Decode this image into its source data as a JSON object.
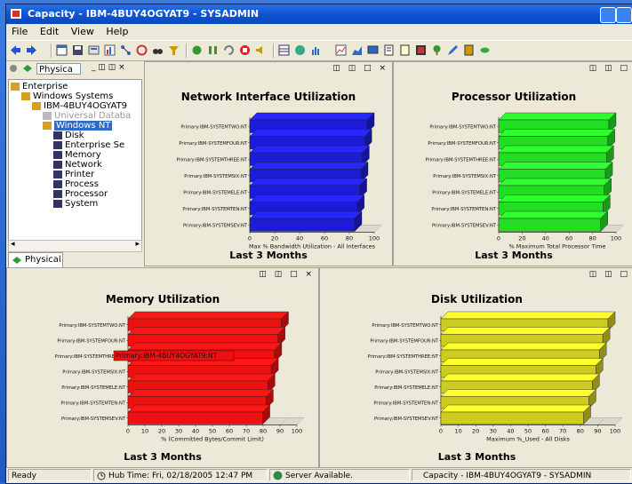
{
  "window": {
    "title": "Capacity - IBM-4BUY4OGYAT9 - SYSADMIN"
  },
  "menu": [
    "File",
    "Edit",
    "View",
    "Help"
  ],
  "navigator": {
    "selector": "Physica",
    "tree": [
      {
        "label": "Enterprise",
        "level": 0
      },
      {
        "label": "Windows Systems",
        "level": 1
      },
      {
        "label": "IBM-4BUY4OGYAT9",
        "level": 2
      },
      {
        "label": "Universal Databa",
        "level": 3,
        "dim": true
      },
      {
        "label": "Windows NT",
        "level": 3,
        "selected": true
      },
      {
        "label": "Disk",
        "level": 4
      },
      {
        "label": "Enterprise Se",
        "level": 4
      },
      {
        "label": "Memory",
        "level": 4
      },
      {
        "label": "Network",
        "level": 4
      },
      {
        "label": "Printer",
        "level": 4
      },
      {
        "label": "Process",
        "level": 4
      },
      {
        "label": "Processor",
        "level": 4
      },
      {
        "label": "System",
        "level": 4
      }
    ],
    "tab": "Physical"
  },
  "panels": {
    "network": {
      "title": "Network Interface Utilization",
      "footer": "Last 3 Months"
    },
    "processor": {
      "title": "Processor Utilization",
      "footer": "Last 3 Months"
    },
    "memory": {
      "title": "Memory Utilization",
      "footer": "Last 3 Months"
    },
    "disk": {
      "title": "Disk Utilization",
      "footer": "Last 3 Months"
    }
  },
  "chart_data": [
    {
      "type": "bar",
      "orientation": "horizontal",
      "title": "Network Interface Utilization",
      "xlabel": "Max % Bandwidth Utilization - All Interfaces",
      "categories": [
        "Primary:IBM-SYSTEMTWO:NT",
        "Primary:IBM-SYSTEMFOUR:NT",
        "Primary:IBM-SYSTEMTHREE:NT",
        "Primary:IBM-SYSTEMSIX:NT",
        "Primary:IBM-SYSTEMELE:NT",
        "Primary:IBM-SYSTEMTEN:NT",
        "Primary:IBM-SYSTEMSEV:NT"
      ],
      "values": [
        100,
        98,
        96,
        95,
        94,
        92,
        90
      ],
      "xlim": [
        0,
        100
      ],
      "ticks": [
        0,
        20,
        40,
        60,
        80,
        100
      ],
      "color": "#1c1cd8"
    },
    {
      "type": "bar",
      "orientation": "horizontal",
      "title": "Processor Utilization",
      "xlabel": "% Maximum Total Processor Time",
      "categories": [
        "Primary:IBM-SYSTEMTWO:NT",
        "Primary:IBM-SYSTEMFOUR:NT",
        "Primary:IBM-SYSTEMTHREE:NT",
        "Primary:IBM-SYSTEMSIX:NT",
        "Primary:IBM-SYSTEMELE:NT",
        "Primary:IBM-SYSTEMTEN:NT",
        "Primary:IBM-SYSTEMSEV:NT"
      ],
      "values": [
        100,
        99,
        98,
        97,
        96,
        95,
        93
      ],
      "xlim": [
        0,
        100
      ],
      "ticks": [
        0,
        20,
        40,
        60,
        80,
        100
      ],
      "color": "#22dd22"
    },
    {
      "type": "bar",
      "orientation": "horizontal",
      "title": "Memory Utilization",
      "xlabel": "% (Committed Bytes/Commit Limit)",
      "categories": [
        "Primary:IBM-SYSTEMTWO:NT",
        "Primary:IBM-SYSTEMFOUR:NT",
        "Primary:IBM-SYSTEMTHREE:NT",
        "Primary:IBM-SYSTEMSIX:NT",
        "Primary:IBM-SYSTEMELE:NT",
        "Primary:IBM-SYSTEMTEN:NT",
        "Primary:IBM-SYSTEMSEV:NT"
      ],
      "values": [
        95,
        93,
        91,
        89,
        87,
        86,
        84
      ],
      "xlim": [
        0,
        100
      ],
      "ticks": [
        0,
        10,
        20,
        30,
        40,
        50,
        60,
        70,
        80,
        90,
        100
      ],
      "color": "#ee1111",
      "tooltip": "Primary:IBM-4BUY4OGYAT9:NT"
    },
    {
      "type": "bar",
      "orientation": "horizontal",
      "title": "Disk Utilization",
      "xlabel": "Maximum %_Used - All Disks",
      "categories": [
        "Primary:IBM-SYSTEMTWO:NT",
        "Primary:IBM-SYSTEMFOUR:NT",
        "Primary:IBM-SYSTEMTHREE:NT",
        "Primary:IBM-SYSTEMSIX:NT",
        "Primary:IBM-SYSTEMELE:NT",
        "Primary:IBM-SYSTEMTEN:NT",
        "Primary:IBM-SYSTEMSEV:NT"
      ],
      "values": [
        100,
        97,
        95,
        93,
        91,
        89,
        86
      ],
      "xlim": [
        0,
        100
      ],
      "ticks": [
        0,
        10,
        20,
        30,
        40,
        50,
        60,
        70,
        80,
        90,
        100
      ],
      "color": "#cccc22"
    }
  ],
  "status": {
    "ready": "Ready",
    "hub_time": "Hub Time: Fri, 02/18/2005 12:47 PM",
    "server": "Server Available.",
    "context": "Capacity - IBM-4BUY4OGYAT9 - SYSADMIN"
  }
}
